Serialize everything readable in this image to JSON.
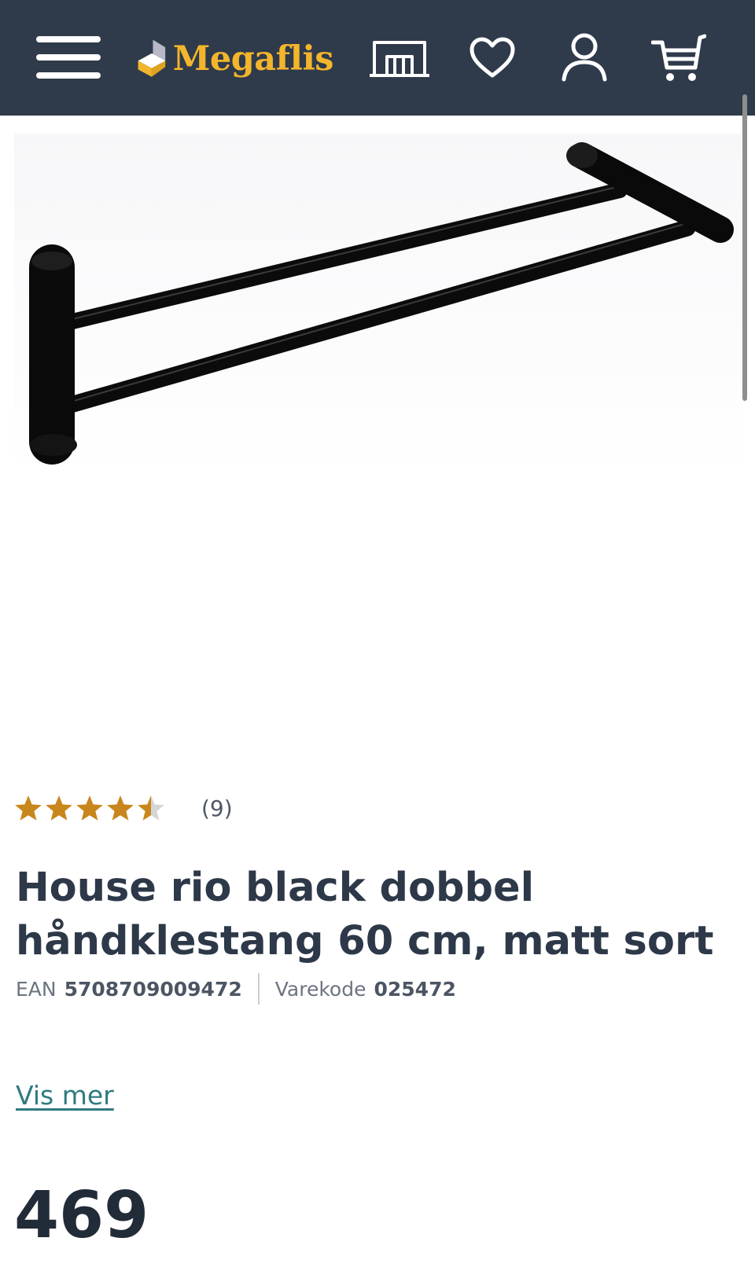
{
  "header": {
    "brand": "Megaflis",
    "colors": {
      "bar": "#2f3a4b",
      "brand": "#f3b52b",
      "icon": "#ffffff"
    },
    "icons": [
      "menu-icon",
      "logo-mark",
      "showroom-icon",
      "heart-icon",
      "user-icon",
      "cart-icon"
    ]
  },
  "product": {
    "rating": {
      "stars": 4.5,
      "max": 5,
      "count_label": "(9)",
      "star_color": "#c9861c"
    },
    "title": "House rio black dobbel håndklestang 60 cm, matt sort",
    "ean_label": "EAN",
    "ean_value": "5708709009472",
    "code_label": "Varekode",
    "code_value": "025472",
    "show_more": "Vis mer",
    "price": "469"
  }
}
